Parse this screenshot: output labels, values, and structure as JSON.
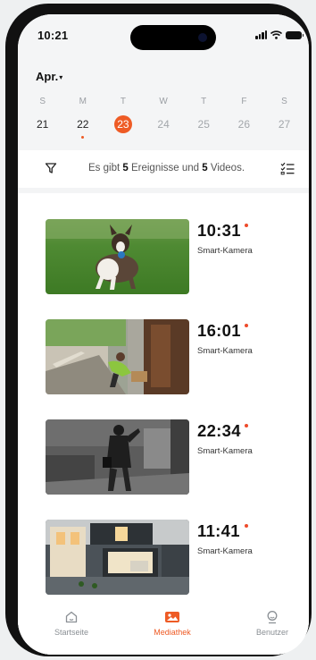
{
  "status_bar": {
    "time": "10:21"
  },
  "calendar": {
    "month": "Apr.",
    "days": [
      {
        "dow": "S",
        "date": "21",
        "state": "normal",
        "has_events": false
      },
      {
        "dow": "M",
        "date": "22",
        "state": "normal",
        "has_events": true
      },
      {
        "dow": "T",
        "date": "23",
        "state": "selected",
        "has_events": false
      },
      {
        "dow": "W",
        "date": "24",
        "state": "muted",
        "has_events": false
      },
      {
        "dow": "T",
        "date": "25",
        "state": "muted",
        "has_events": false
      },
      {
        "dow": "F",
        "date": "26",
        "state": "muted",
        "has_events": false
      },
      {
        "dow": "S",
        "date": "27",
        "state": "muted",
        "has_events": false
      }
    ]
  },
  "summary": {
    "prefix": "Es gibt",
    "event_count": "5",
    "middle": "Ereignisse und",
    "video_count": "5",
    "suffix": "Videos."
  },
  "events": [
    {
      "time": "10:31",
      "camera": "Smart-Kamera",
      "scene": "dog-on-lawn"
    },
    {
      "time": "16:01",
      "camera": "Smart-Kamera",
      "scene": "package-delivery"
    },
    {
      "time": "22:34",
      "camera": "Smart-Kamera",
      "scene": "night-intruder"
    },
    {
      "time": "11:41",
      "camera": "Smart-Kamera",
      "scene": "house-exterior"
    }
  ],
  "tabs": [
    {
      "label": "Startseite",
      "icon": "home-icon",
      "active": false
    },
    {
      "label": "Mediathek",
      "icon": "gallery-icon",
      "active": true
    },
    {
      "label": "Benutzer",
      "icon": "user-icon",
      "active": false
    }
  ],
  "colors": {
    "accent": "#ee5b25",
    "event_dot": "#ee4b2b"
  }
}
